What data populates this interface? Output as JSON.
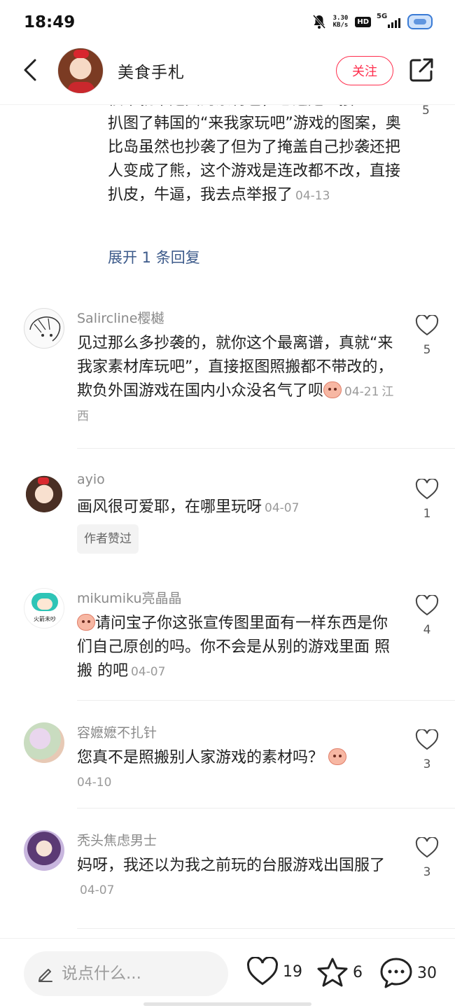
{
  "status_bar": {
    "time": "18:49",
    "net_speed_value": "3.30",
    "net_speed_unit": "KB/s",
    "hd_label": "HD",
    "network_label": "5G"
  },
  "header": {
    "author_name": "美食手札",
    "follow_label": "关注",
    "icons": {
      "back": "chevron-left-icon",
      "share": "share-icon"
    }
  },
  "partial_reply": {
    "line_cut": "很本就不是真的素材包，它这是直接",
    "text": "扒图了韩国的“来我家玩吧”游戏的图案，奥比岛虽然也抄袭了但为了掩盖自己抄袭还把人变成了熊，这个游戏是连改都不改，直接扒皮，牛逼，我去点举报了",
    "date": "04-13",
    "side_count": "5",
    "expand_label": "展开 1 条回复"
  },
  "comments": [
    {
      "user": "Salircline樱樾",
      "text": "见过那么多抄袭的，就你这个最离谱，真就“来我家素材库玩吧”，直接抠图照搬都不带改的，欺负外国游戏在国内小众没名气了呗",
      "date": "04-21",
      "location": "江西",
      "likes": "5"
    },
    {
      "user": "ayio",
      "text": "画风很可爱耶，在哪里玩呀",
      "date": "04-07",
      "tag": "作者赞过",
      "likes": "1"
    },
    {
      "user": "mikumiku亮晶晶",
      "avatar_text": "火箭未吵",
      "text": "请问宝子你这张宣传图里面有一样东西是你们自己原创的吗。你不会是从别的游戏里面  照搬  的吧",
      "date": "04-07",
      "likes": "4"
    },
    {
      "user": "容嬷嬷不扎针",
      "text": "您真不是照搬别人家游戏的素材吗？",
      "date": "04-10",
      "likes": "3"
    },
    {
      "user": "秃头焦虑男士",
      "text": "妈呀，我还以为我之前玩的台服游戏出国服了",
      "date": "04-07",
      "likes": "3"
    }
  ],
  "bottom_bar": {
    "input_placeholder": "说点什么...",
    "likes": "19",
    "favorites": "6",
    "comments": "30"
  },
  "colors": {
    "accent": "#ff2e4d",
    "link": "#3c5a8a",
    "meta": "#9a9a9a"
  }
}
